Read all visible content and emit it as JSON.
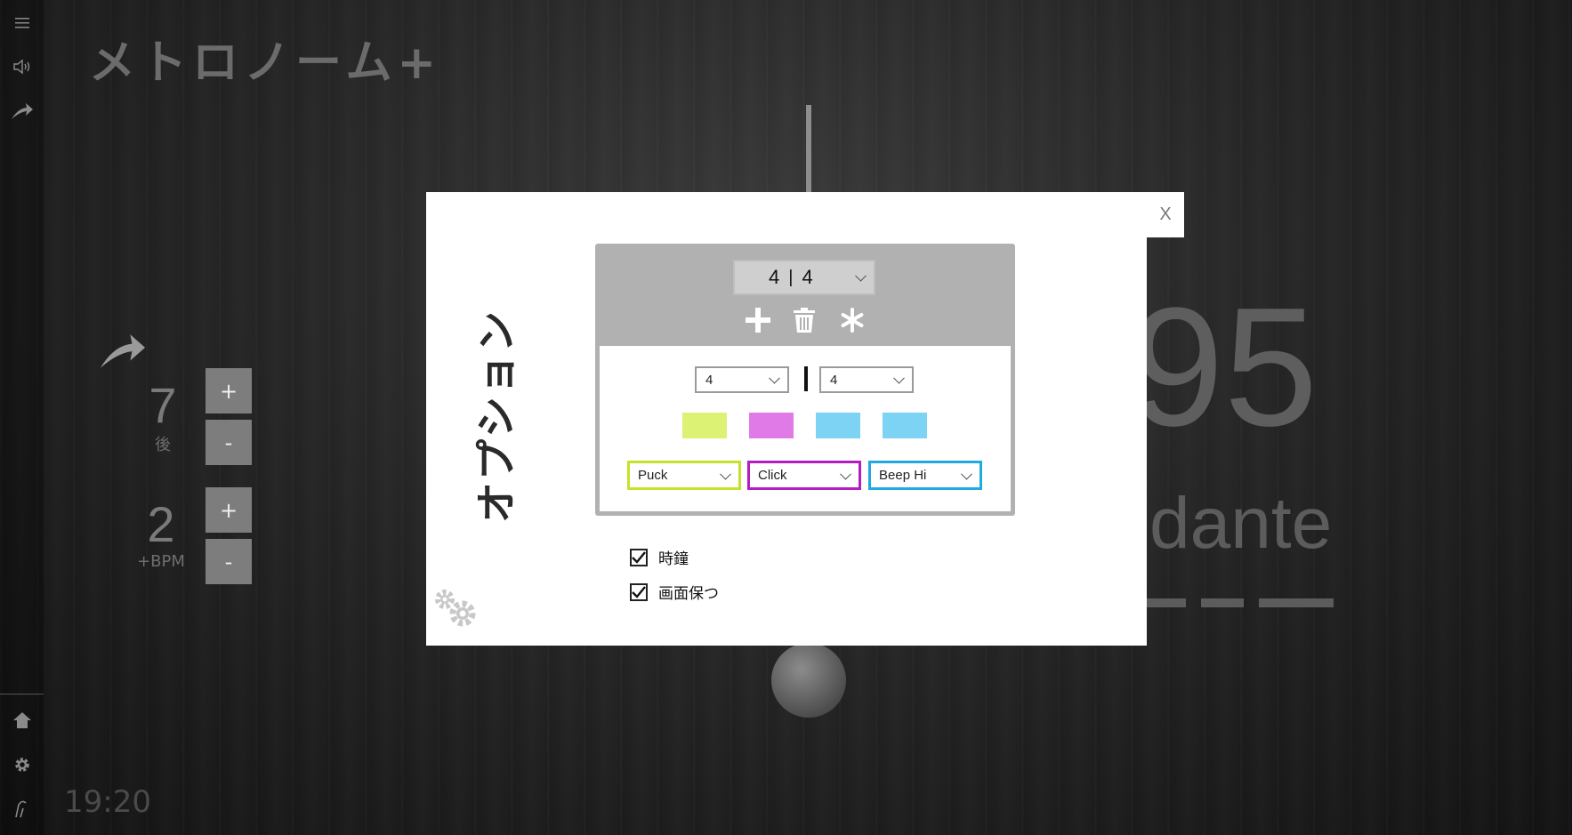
{
  "app": {
    "title": "メトロノーム+",
    "clock": "19:20"
  },
  "rail": {
    "top": [
      {
        "icon": "hamburger-menu-icon"
      },
      {
        "icon": "speaker-icon"
      },
      {
        "icon": "curved-arrow-icon"
      }
    ],
    "bottom": [
      {
        "icon": "home-icon"
      },
      {
        "icon": "gear-icon"
      },
      {
        "icon": "conductor-baton-icon"
      }
    ]
  },
  "background": {
    "bpm": "95",
    "tempo_name": "dante",
    "counters": [
      {
        "value": "7",
        "sublabel": "後",
        "plus": "+",
        "minus": "-"
      },
      {
        "value": "2",
        "sublabel": "+BPM",
        "plus": "+",
        "minus": "-"
      }
    ]
  },
  "dialog": {
    "title": "オプション",
    "close_label": "X",
    "preset": {
      "numerator": "4",
      "sep": "|",
      "denominator": "4"
    },
    "toolbar": [
      {
        "icon": "plus-icon"
      },
      {
        "icon": "trash-icon"
      },
      {
        "icon": "asterisk-icon"
      }
    ],
    "time_signature": {
      "beats": "4",
      "note_value": "4"
    },
    "beat_colors": [
      "#dcf274",
      "#e07ae6",
      "#7cd3f4",
      "#7cd3f4"
    ],
    "sounds": [
      {
        "label": "Puck",
        "border": "#c6e22a"
      },
      {
        "label": "Click",
        "border": "#b21ec0"
      },
      {
        "label": "Beep Hi",
        "border": "#21a9e2"
      }
    ],
    "options": [
      {
        "label": "時鐘",
        "checked": true
      },
      {
        "label": "画面保つ",
        "checked": true
      }
    ]
  }
}
